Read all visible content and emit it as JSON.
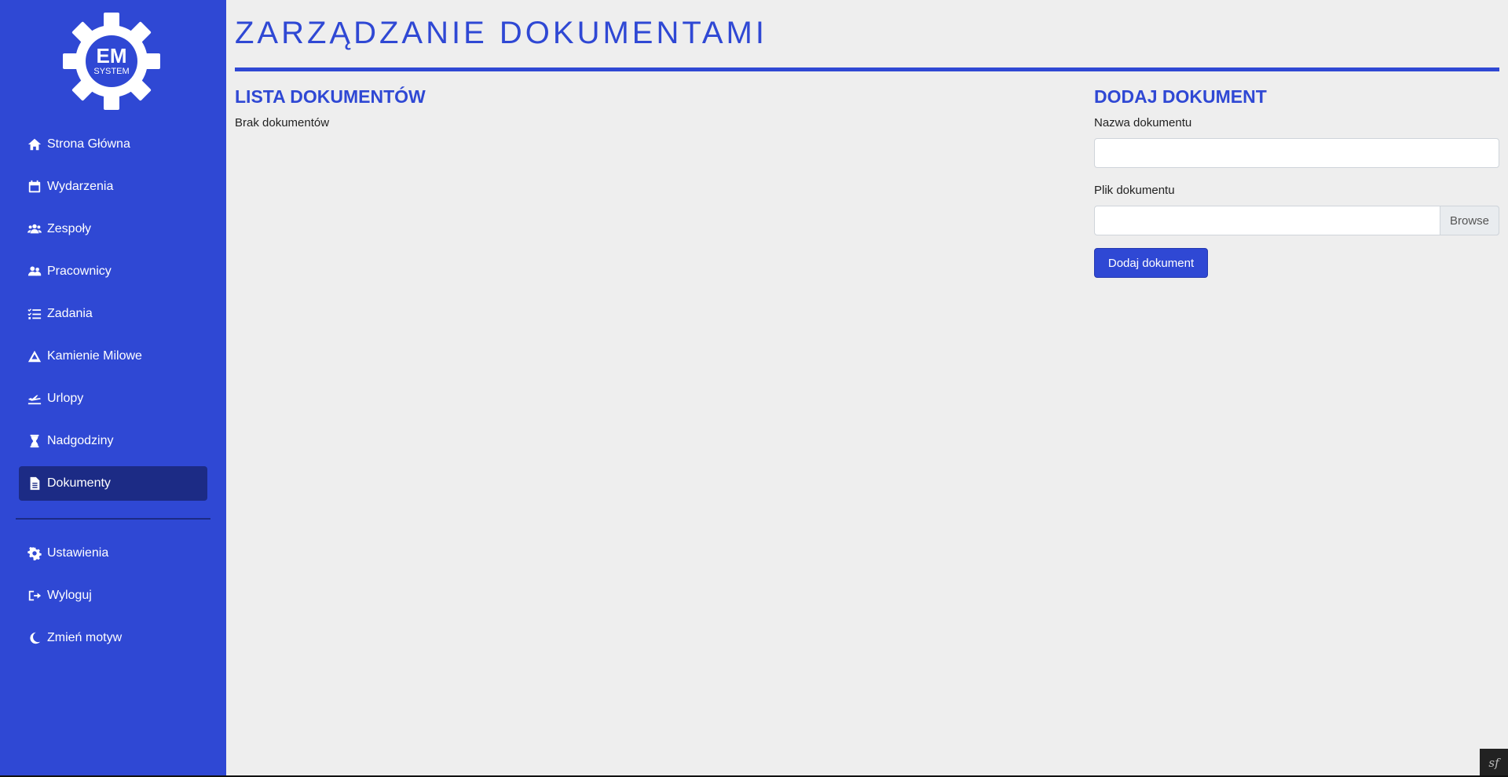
{
  "logo": {
    "main": "EM",
    "sub": "SYSTEM"
  },
  "sidebar": {
    "items": [
      {
        "label": "Strona Główna",
        "icon": "home-icon"
      },
      {
        "label": "Wydarzenia",
        "icon": "calendar-icon"
      },
      {
        "label": "Zespoły",
        "icon": "users-icon"
      },
      {
        "label": "Pracownicy",
        "icon": "user-group-icon"
      },
      {
        "label": "Zadania",
        "icon": "tasks-icon"
      },
      {
        "label": "Kamienie Milowe",
        "icon": "mountain-icon"
      },
      {
        "label": "Urlopy",
        "icon": "plane-icon"
      },
      {
        "label": "Nadgodziny",
        "icon": "hourglass-icon"
      },
      {
        "label": "Dokumenty",
        "icon": "file-icon",
        "active": true
      }
    ],
    "bottom_items": [
      {
        "label": "Ustawienia",
        "icon": "gear-icon"
      },
      {
        "label": "Wyloguj",
        "icon": "logout-icon"
      },
      {
        "label": "Zmień motyw",
        "icon": "moon-icon"
      }
    ]
  },
  "page": {
    "title": "ZARZĄDZANIE DOKUMENTAMI"
  },
  "list": {
    "title": "LISTA DOKUMENTÓW",
    "empty": "Brak dokumentów"
  },
  "form": {
    "title": "DODAJ DOKUMENT",
    "name_label": "Nazwa dokumentu",
    "name_value": "",
    "file_label": "Plik dokumentu",
    "file_value": "",
    "browse_label": "Browse",
    "submit_label": "Dodaj dokument"
  },
  "toolbar": {
    "symfony_label": "sf"
  },
  "colors": {
    "accent": "#2f48d4",
    "active": "#1c2b85",
    "background": "#eeeeee"
  }
}
